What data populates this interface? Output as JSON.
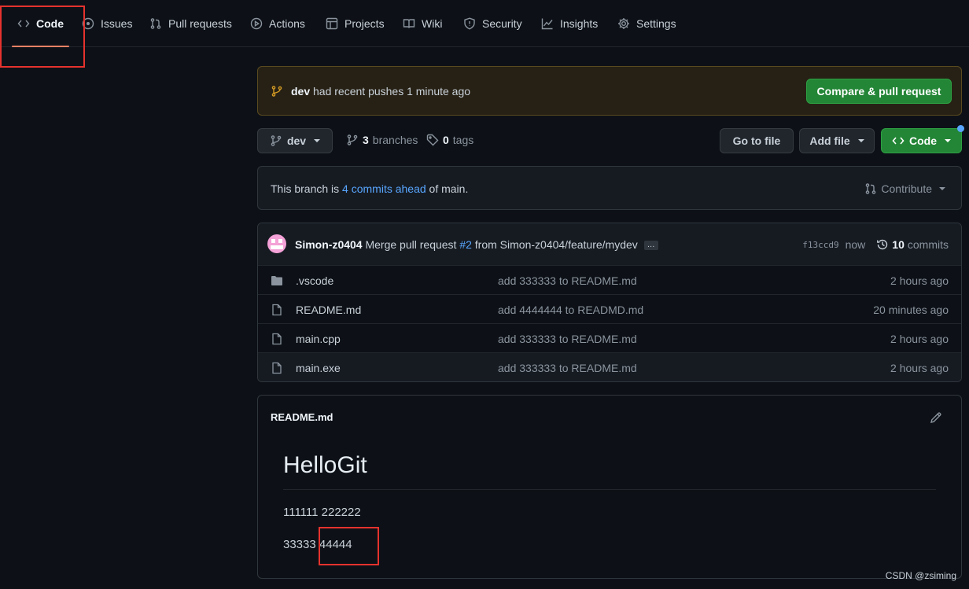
{
  "nav": {
    "code": "Code",
    "issues": "Issues",
    "pulls": "Pull requests",
    "actions": "Actions",
    "projects": "Projects",
    "wiki": "Wiki",
    "security": "Security",
    "insights": "Insights",
    "settings": "Settings"
  },
  "banner": {
    "branch": "dev",
    "text": "had recent pushes 1 minute ago",
    "button": "Compare & pull request"
  },
  "toolbar": {
    "branch": "dev",
    "branches_count": "3",
    "branches_label": "branches",
    "tags_count": "0",
    "tags_label": "tags",
    "go_to_file": "Go to file",
    "add_file": "Add file",
    "code": "Code"
  },
  "ahead": {
    "prefix": "This branch is",
    "link": "4 commits ahead",
    "suffix": "of main.",
    "contribute": "Contribute"
  },
  "commit": {
    "author": "Simon-z0404",
    "msg_prefix": "Merge pull request",
    "pr": "#2",
    "msg_suffix": "from Simon-z0404/feature/mydev",
    "ellipsis": "…",
    "sha": "f13ccd9",
    "when": "now",
    "count": "10",
    "count_label": "commits"
  },
  "files": [
    {
      "name": ".vscode",
      "type": "folder",
      "message": "add 333333 to README.md",
      "age": "2 hours ago"
    },
    {
      "name": "README.md",
      "type": "file",
      "message": "add 4444444 to READMD.md",
      "age": "20 minutes ago"
    },
    {
      "name": "main.cpp",
      "type": "file",
      "message": "add 333333 to README.md",
      "age": "2 hours ago"
    },
    {
      "name": "main.exe",
      "type": "file",
      "message": "add 333333 to README.md",
      "age": "2 hours ago"
    }
  ],
  "readme": {
    "filename": "README.md",
    "title": "HelloGit",
    "line1": "111111 222222",
    "line2_a": "33333",
    "line2_b": "44444"
  },
  "watermark": "CSDN @zsiming",
  "colors": {
    "background": "#0d1117",
    "accent_green": "#238636",
    "link": "#58a6ff",
    "highlight_box": "#e5322d",
    "active_tab_underline": "#f78166"
  }
}
